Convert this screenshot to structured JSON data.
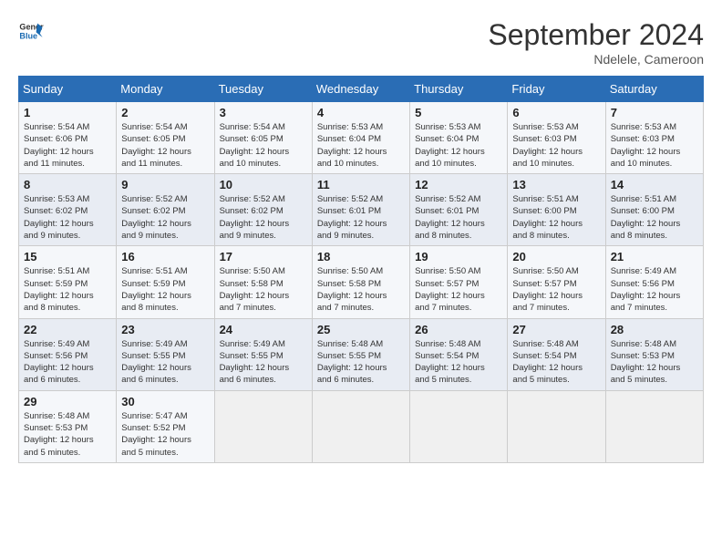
{
  "header": {
    "logo_line1": "General",
    "logo_line2": "Blue",
    "month": "September 2024",
    "location": "Ndelele, Cameroon"
  },
  "weekdays": [
    "Sunday",
    "Monday",
    "Tuesday",
    "Wednesday",
    "Thursday",
    "Friday",
    "Saturday"
  ],
  "weeks": [
    [
      {
        "day": "1",
        "info": "Sunrise: 5:54 AM\nSunset: 6:06 PM\nDaylight: 12 hours\nand 11 minutes."
      },
      {
        "day": "2",
        "info": "Sunrise: 5:54 AM\nSunset: 6:05 PM\nDaylight: 12 hours\nand 11 minutes."
      },
      {
        "day": "3",
        "info": "Sunrise: 5:54 AM\nSunset: 6:05 PM\nDaylight: 12 hours\nand 10 minutes."
      },
      {
        "day": "4",
        "info": "Sunrise: 5:53 AM\nSunset: 6:04 PM\nDaylight: 12 hours\nand 10 minutes."
      },
      {
        "day": "5",
        "info": "Sunrise: 5:53 AM\nSunset: 6:04 PM\nDaylight: 12 hours\nand 10 minutes."
      },
      {
        "day": "6",
        "info": "Sunrise: 5:53 AM\nSunset: 6:03 PM\nDaylight: 12 hours\nand 10 minutes."
      },
      {
        "day": "7",
        "info": "Sunrise: 5:53 AM\nSunset: 6:03 PM\nDaylight: 12 hours\nand 10 minutes."
      }
    ],
    [
      {
        "day": "8",
        "info": "Sunrise: 5:53 AM\nSunset: 6:02 PM\nDaylight: 12 hours\nand 9 minutes."
      },
      {
        "day": "9",
        "info": "Sunrise: 5:52 AM\nSunset: 6:02 PM\nDaylight: 12 hours\nand 9 minutes."
      },
      {
        "day": "10",
        "info": "Sunrise: 5:52 AM\nSunset: 6:02 PM\nDaylight: 12 hours\nand 9 minutes."
      },
      {
        "day": "11",
        "info": "Sunrise: 5:52 AM\nSunset: 6:01 PM\nDaylight: 12 hours\nand 9 minutes."
      },
      {
        "day": "12",
        "info": "Sunrise: 5:52 AM\nSunset: 6:01 PM\nDaylight: 12 hours\nand 8 minutes."
      },
      {
        "day": "13",
        "info": "Sunrise: 5:51 AM\nSunset: 6:00 PM\nDaylight: 12 hours\nand 8 minutes."
      },
      {
        "day": "14",
        "info": "Sunrise: 5:51 AM\nSunset: 6:00 PM\nDaylight: 12 hours\nand 8 minutes."
      }
    ],
    [
      {
        "day": "15",
        "info": "Sunrise: 5:51 AM\nSunset: 5:59 PM\nDaylight: 12 hours\nand 8 minutes."
      },
      {
        "day": "16",
        "info": "Sunrise: 5:51 AM\nSunset: 5:59 PM\nDaylight: 12 hours\nand 8 minutes."
      },
      {
        "day": "17",
        "info": "Sunrise: 5:50 AM\nSunset: 5:58 PM\nDaylight: 12 hours\nand 7 minutes."
      },
      {
        "day": "18",
        "info": "Sunrise: 5:50 AM\nSunset: 5:58 PM\nDaylight: 12 hours\nand 7 minutes."
      },
      {
        "day": "19",
        "info": "Sunrise: 5:50 AM\nSunset: 5:57 PM\nDaylight: 12 hours\nand 7 minutes."
      },
      {
        "day": "20",
        "info": "Sunrise: 5:50 AM\nSunset: 5:57 PM\nDaylight: 12 hours\nand 7 minutes."
      },
      {
        "day": "21",
        "info": "Sunrise: 5:49 AM\nSunset: 5:56 PM\nDaylight: 12 hours\nand 7 minutes."
      }
    ],
    [
      {
        "day": "22",
        "info": "Sunrise: 5:49 AM\nSunset: 5:56 PM\nDaylight: 12 hours\nand 6 minutes."
      },
      {
        "day": "23",
        "info": "Sunrise: 5:49 AM\nSunset: 5:55 PM\nDaylight: 12 hours\nand 6 minutes."
      },
      {
        "day": "24",
        "info": "Sunrise: 5:49 AM\nSunset: 5:55 PM\nDaylight: 12 hours\nand 6 minutes."
      },
      {
        "day": "25",
        "info": "Sunrise: 5:48 AM\nSunset: 5:55 PM\nDaylight: 12 hours\nand 6 minutes."
      },
      {
        "day": "26",
        "info": "Sunrise: 5:48 AM\nSunset: 5:54 PM\nDaylight: 12 hours\nand 5 minutes."
      },
      {
        "day": "27",
        "info": "Sunrise: 5:48 AM\nSunset: 5:54 PM\nDaylight: 12 hours\nand 5 minutes."
      },
      {
        "day": "28",
        "info": "Sunrise: 5:48 AM\nSunset: 5:53 PM\nDaylight: 12 hours\nand 5 minutes."
      }
    ],
    [
      {
        "day": "29",
        "info": "Sunrise: 5:48 AM\nSunset: 5:53 PM\nDaylight: 12 hours\nand 5 minutes."
      },
      {
        "day": "30",
        "info": "Sunrise: 5:47 AM\nSunset: 5:52 PM\nDaylight: 12 hours\nand 5 minutes."
      },
      {
        "day": "",
        "info": ""
      },
      {
        "day": "",
        "info": ""
      },
      {
        "day": "",
        "info": ""
      },
      {
        "day": "",
        "info": ""
      },
      {
        "day": "",
        "info": ""
      }
    ]
  ]
}
